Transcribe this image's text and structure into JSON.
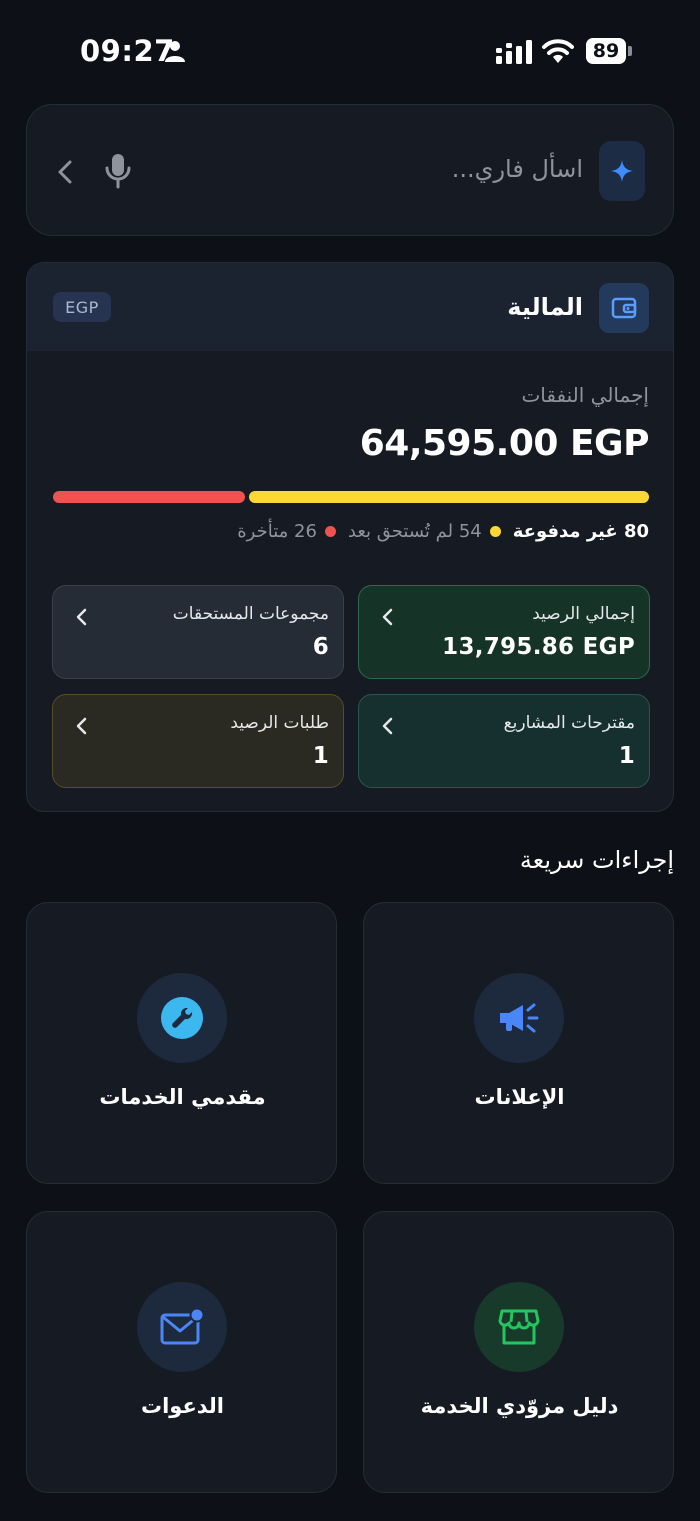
{
  "status_bar": {
    "time": "09:27",
    "battery": "89",
    "icons": [
      "person-icon",
      "signal-icon",
      "wifi-icon",
      "battery-icon"
    ]
  },
  "search": {
    "placeholder": "اسأل فاري...",
    "icons": [
      "sparkle-icon",
      "mic-icon",
      "chevron-left-icon"
    ]
  },
  "finance": {
    "title": "المالية",
    "currency_badge": "EGP",
    "total_spend_label": "إجمالي النفقات",
    "total_spend_amount": "64,595.00 EGP",
    "breakdown": {
      "unpaid": "80 غير مدفوعة",
      "not_due": "54 لم تُستحق بعد",
      "overdue": "26 متأخرة",
      "overdue_count": 26,
      "not_due_count": 54
    },
    "tiles": {
      "balance": {
        "label": "إجمالي الرصيد",
        "value": "13,795.86 EGP"
      },
      "dues_groups": {
        "label": "مجموعات المستحقات",
        "value": "6"
      },
      "project_proposals": {
        "label": "مقترحات المشاريع",
        "value": "1"
      },
      "balance_requests": {
        "label": "طلبات الرصيد",
        "value": "1"
      }
    },
    "colors": {
      "overdue": "#ef5350",
      "not_due": "#fdd835"
    }
  },
  "quick_actions": {
    "title": "إجراءات سريعة",
    "items": [
      {
        "label": "الإعلانات",
        "icon": "megaphone-icon"
      },
      {
        "label": "مقدمي الخدمات",
        "icon": "wrench-icon"
      },
      {
        "label": "دليل مزوّدي الخدمة",
        "icon": "store-icon"
      },
      {
        "label": "الدعوات",
        "icon": "mail-icon"
      }
    ]
  }
}
